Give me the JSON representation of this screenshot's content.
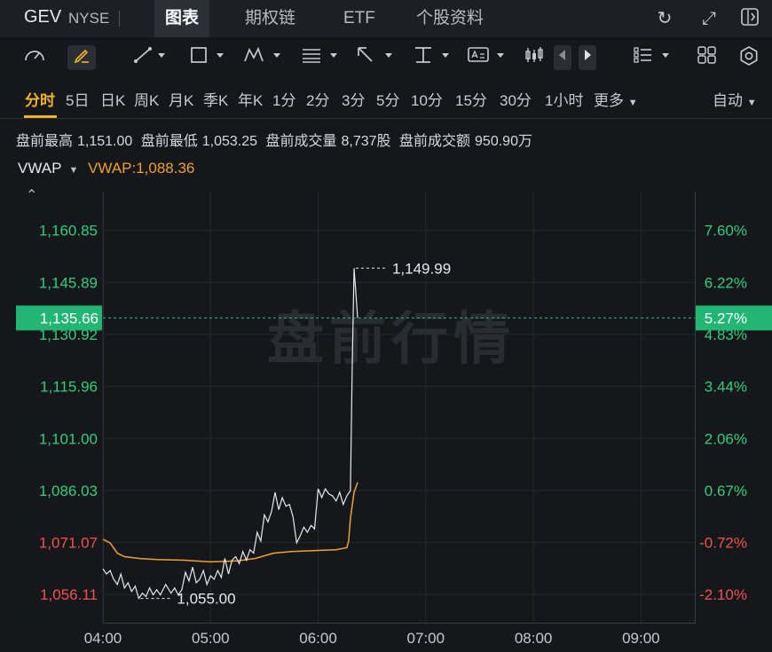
{
  "header": {
    "ticker": "GEV",
    "exchange": "NYSE",
    "tabs": [
      {
        "label": "图表",
        "active": true
      },
      {
        "label": "期权链",
        "active": false
      },
      {
        "label": "ETF",
        "active": false
      },
      {
        "label": "个股资料",
        "active": false
      }
    ],
    "icons": [
      "refresh-icon",
      "fullscreen-icon",
      "collapse-panel-icon"
    ]
  },
  "toolbar": {
    "icons": [
      "speedometer-icon",
      "draw-pen-icon",
      "line-tool-icon",
      "rectangle-tool-icon",
      "pattern-tool-icon",
      "fib-tool-icon",
      "arrow-tool-icon",
      "text-tool-icon",
      "annotation-tool-icon",
      "candles-icon",
      "prev-arrow-icon",
      "next-arrow-icon",
      "list-icon",
      "grid-icon",
      "settings-icon"
    ]
  },
  "periods": {
    "items": [
      "分时",
      "5日",
      "日K",
      "周K",
      "月K",
      "季K",
      "年K",
      "1分",
      "2分",
      "3分",
      "5分",
      "10分",
      "15分",
      "30分",
      "1小时",
      "更多"
    ],
    "active": "分时",
    "auto_label": "自动"
  },
  "stats": [
    {
      "label": "盘前最高",
      "value": "1,151.00"
    },
    {
      "label": "盘前最低",
      "value": "1,053.25"
    },
    {
      "label": "盘前成交量",
      "value": "8,737股"
    },
    {
      "label": "盘前成交额",
      "value": "950.90万"
    }
  ],
  "indicator": {
    "name": "VWAP",
    "value_text": "VWAP:1,088.36"
  },
  "chart_data": {
    "type": "line",
    "watermark": "盘前行情",
    "x_ticks": [
      "04:00",
      "05:00",
      "06:00",
      "07:00",
      "08:00",
      "09:00"
    ],
    "x_range": [
      "04:00",
      "09:30"
    ],
    "y_range": [
      1048.0,
      1172.0
    ],
    "y_ticks": [
      {
        "price": "1,160.85",
        "pct": "7.60%",
        "dir": "up"
      },
      {
        "price": "1,145.89",
        "pct": "6.22%",
        "dir": "up"
      },
      {
        "price": "1,130.92",
        "pct": "4.83%",
        "dir": "up"
      },
      {
        "price": "1,115.96",
        "pct": "3.44%",
        "dir": "up"
      },
      {
        "price": "1,101.00",
        "pct": "2.06%",
        "dir": "up"
      },
      {
        "price": "1,086.03",
        "pct": "0.67%",
        "dir": "up"
      },
      {
        "price": "1,071.07",
        "pct": "-0.72%",
        "dir": "down"
      },
      {
        "price": "1,056.11",
        "pct": "-2.10%",
        "dir": "down"
      }
    ],
    "current": {
      "price": "1,135.66",
      "pct": "5.27%"
    },
    "annotations": [
      {
        "text": "1,149.99",
        "time": "06:20",
        "value": 1149.99
      },
      {
        "text": "1,055.00",
        "time": "04:20",
        "value": 1055.0
      }
    ],
    "colors": {
      "up": "#2fcf7f",
      "down": "#ef5350",
      "price_line": "#e8e8ee",
      "vwap_line": "#f0a030",
      "current_tag": "#22b573"
    },
    "series": [
      {
        "key": "price",
        "points": [
          [
            "04:00",
            1063.5
          ],
          [
            "04:02",
            1062.0
          ],
          [
            "04:04",
            1063.0
          ],
          [
            "04:06",
            1060.5
          ],
          [
            "04:08",
            1059.0
          ],
          [
            "04:10",
            1062.0
          ],
          [
            "04:12",
            1058.0
          ],
          [
            "04:14",
            1059.5
          ],
          [
            "04:16",
            1057.0
          ],
          [
            "04:18",
            1058.5
          ],
          [
            "04:20",
            1055.0
          ],
          [
            "04:22",
            1056.5
          ],
          [
            "04:24",
            1055.5
          ],
          [
            "04:26",
            1058.0
          ],
          [
            "04:28",
            1056.0
          ],
          [
            "04:30",
            1057.5
          ],
          [
            "04:32",
            1056.0
          ],
          [
            "04:35",
            1059.0
          ],
          [
            "04:38",
            1056.5
          ],
          [
            "04:40",
            1058.0
          ],
          [
            "04:42",
            1056.0
          ],
          [
            "04:44",
            1057.5
          ],
          [
            "04:46",
            1062.5
          ],
          [
            "04:48",
            1060.0
          ],
          [
            "04:50",
            1064.0
          ],
          [
            "04:52",
            1059.5
          ],
          [
            "04:54",
            1060.5
          ],
          [
            "04:56",
            1063.0
          ],
          [
            "04:58",
            1059.0
          ],
          [
            "05:00",
            1061.5
          ],
          [
            "05:02",
            1060.5
          ],
          [
            "05:04",
            1063.0
          ],
          [
            "05:06",
            1061.0
          ],
          [
            "05:08",
            1066.5
          ],
          [
            "05:10",
            1062.0
          ],
          [
            "05:12",
            1066.0
          ],
          [
            "05:14",
            1067.0
          ],
          [
            "05:16",
            1065.0
          ],
          [
            "05:18",
            1068.5
          ],
          [
            "05:20",
            1066.0
          ],
          [
            "05:22",
            1069.0
          ],
          [
            "05:24",
            1068.0
          ],
          [
            "05:26",
            1074.0
          ],
          [
            "05:28",
            1071.5
          ],
          [
            "05:30",
            1079.0
          ],
          [
            "05:32",
            1077.0
          ],
          [
            "05:34",
            1080.0
          ],
          [
            "05:36",
            1085.5
          ],
          [
            "05:38",
            1080.5
          ],
          [
            "05:40",
            1084.0
          ],
          [
            "05:42",
            1081.5
          ],
          [
            "05:44",
            1082.0
          ],
          [
            "05:46",
            1078.5
          ],
          [
            "05:48",
            1071.0
          ],
          [
            "05:50",
            1073.0
          ],
          [
            "05:52",
            1075.5
          ],
          [
            "05:54",
            1074.0
          ],
          [
            "05:56",
            1076.0
          ],
          [
            "05:58",
            1075.0
          ],
          [
            "06:00",
            1086.5
          ],
          [
            "06:02",
            1084.0
          ],
          [
            "06:04",
            1086.5
          ],
          [
            "06:06",
            1085.0
          ],
          [
            "06:08",
            1084.5
          ],
          [
            "06:10",
            1083.0
          ],
          [
            "06:12",
            1085.5
          ],
          [
            "06:14",
            1082.0
          ],
          [
            "06:16",
            1084.5
          ],
          [
            "06:18",
            1086.0
          ],
          [
            "06:19",
            1121.0
          ],
          [
            "06:20",
            1149.99
          ],
          [
            "06:21",
            1143.0
          ],
          [
            "06:22",
            1135.66
          ]
        ]
      },
      {
        "key": "vwap",
        "points": [
          [
            "04:00",
            1072.0
          ],
          [
            "04:04",
            1071.0
          ],
          [
            "04:08",
            1068.0
          ],
          [
            "04:12",
            1067.0
          ],
          [
            "04:20",
            1066.5
          ],
          [
            "04:30",
            1066.2
          ],
          [
            "04:45",
            1066.0
          ],
          [
            "05:00",
            1065.5
          ],
          [
            "05:15",
            1065.8
          ],
          [
            "05:25",
            1066.5
          ],
          [
            "05:35",
            1068.0
          ],
          [
            "05:45",
            1068.5
          ],
          [
            "06:00",
            1068.8
          ],
          [
            "06:10",
            1069.0
          ],
          [
            "06:16",
            1069.6
          ],
          [
            "06:17",
            1071.5
          ],
          [
            "06:18",
            1078.0
          ],
          [
            "06:20",
            1085.5
          ],
          [
            "06:22",
            1088.36
          ]
        ]
      }
    ]
  }
}
